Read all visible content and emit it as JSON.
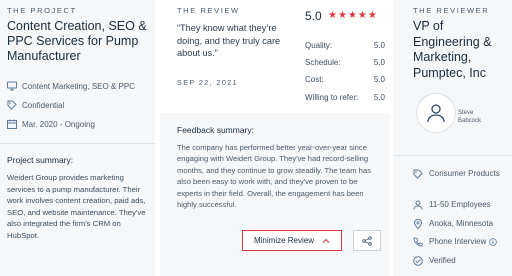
{
  "project": {
    "eyebrow": "THE PROJECT",
    "title": "Content Creation, SEO & PPC Services for Pump Manufacturer",
    "category": "Content Marketing, SEO & PPC",
    "budget": "Confidential",
    "dates": "Mar. 2020 - Ongoing",
    "summary_label": "Project summary:",
    "summary_text": "Weidert Group provides marketing services to a pump manufacturer. Their work involves content creation, paid ads, SEO, and website maintenance. They've also integrated the firm's CRM on HubSpot."
  },
  "review": {
    "eyebrow": "THE REVIEW",
    "quote": "“They know what they’re doing, and they truly care about us.”",
    "date": "SEP 22, 2021",
    "overall": "5.0",
    "stars": 5,
    "ratings": [
      {
        "label": "Quality:",
        "value": "5.0"
      },
      {
        "label": "Schedule:",
        "value": "5.0"
      },
      {
        "label": "Cost:",
        "value": "5.0"
      },
      {
        "label": "Willing to refer:",
        "value": "5.0"
      }
    ],
    "feedback_label": "Feedback summary:",
    "feedback_text": "The company has performed better year-over-year since engaging with Weidert Group. They've had record-selling months, and they continue to grow steadily. The team has also been easy to work with, and they've proven to be experts in their field. Overall, the engagement has been highly successful.",
    "minimize_label": "Minimize Review",
    "accent_color": "#e0383e"
  },
  "reviewer": {
    "eyebrow": "THE REVIEWER",
    "title": "VP of Engineering & Marketing, Pumptec, Inc",
    "name": "Steve Babcock",
    "industry": "Consumer Products",
    "size": "11-50 Employees",
    "location": "Anoka, Minnesota",
    "interview": "Phone Interview",
    "verified": "Verified"
  }
}
